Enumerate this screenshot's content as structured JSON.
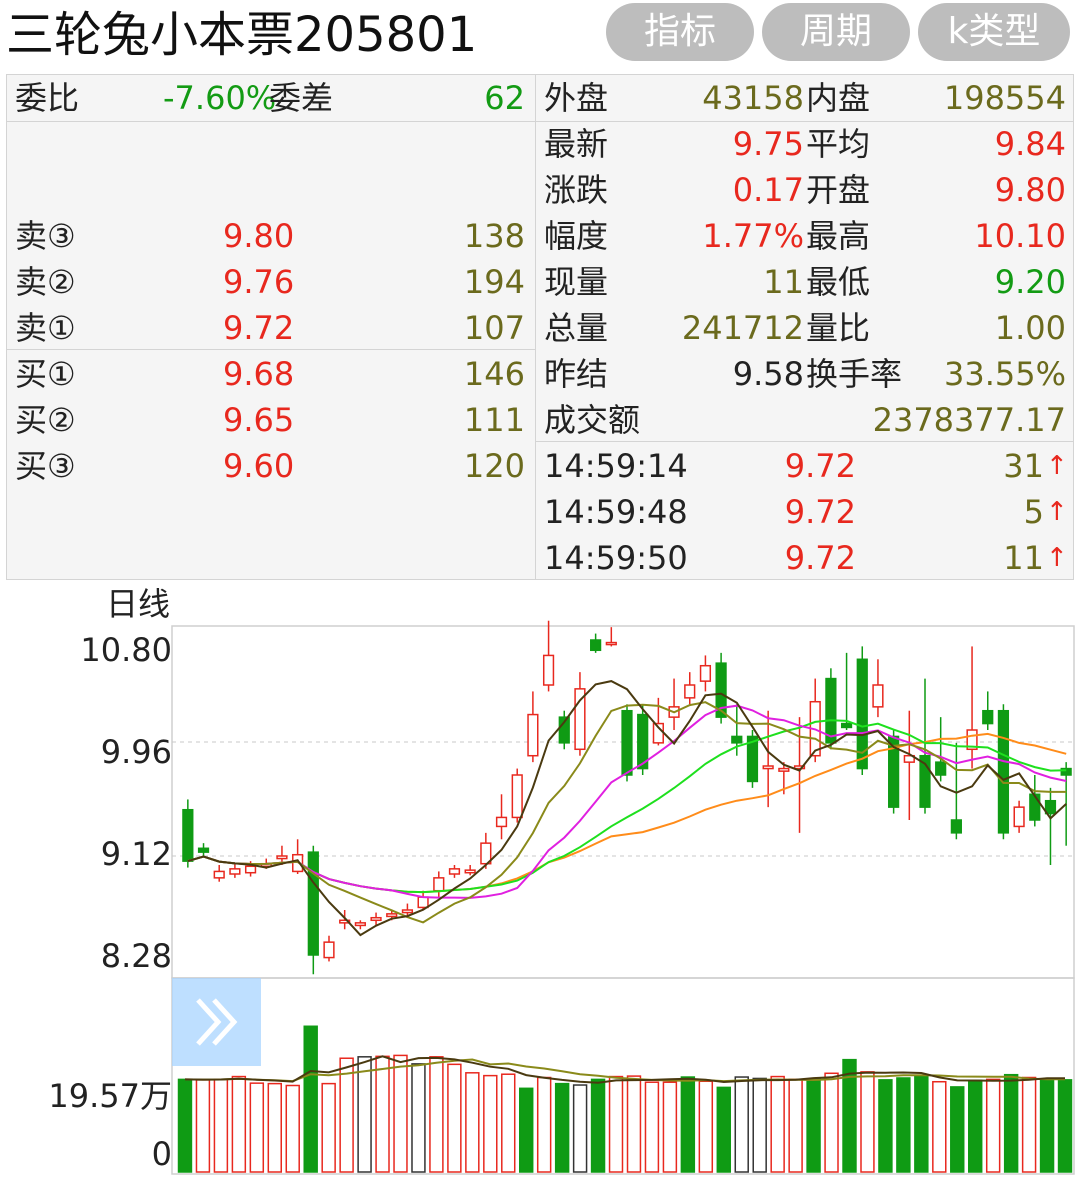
{
  "header": {
    "title": "三轮兔小本票205801",
    "buttons": [
      "指标",
      "周期",
      "k类型"
    ]
  },
  "left_panel": {
    "weibi_label": "委比",
    "weibi_value": "-7.60%",
    "weicha_label": "委差",
    "weicha_value": "62",
    "asks": [
      {
        "label": "卖③",
        "price": "9.80",
        "volume": "138"
      },
      {
        "label": "卖②",
        "price": "9.76",
        "volume": "194"
      },
      {
        "label": "卖①",
        "price": "9.72",
        "volume": "107"
      }
    ],
    "bids": [
      {
        "label": "买①",
        "price": "9.68",
        "volume": "146"
      },
      {
        "label": "买②",
        "price": "9.65",
        "volume": "111"
      },
      {
        "label": "买③",
        "price": "9.60",
        "volume": "120"
      }
    ]
  },
  "right_panel": {
    "waipan_label": "外盘",
    "waipan_value": "43158",
    "neipan_label": "内盘",
    "neipan_value": "198554",
    "stats": [
      {
        "l1": "最新",
        "v1": "9.75",
        "c1": "red",
        "l2": "平均",
        "v2": "9.84",
        "c2": "red"
      },
      {
        "l1": "涨跌",
        "v1": "0.17",
        "c1": "red",
        "l2": "开盘",
        "v2": "9.80",
        "c2": "red"
      },
      {
        "l1": "幅度",
        "v1": "1.77%",
        "c1": "red",
        "l2": "最高",
        "v2": "10.10",
        "c2": "red"
      },
      {
        "l1": "现量",
        "v1": "11",
        "c1": "olive",
        "l2": "最低",
        "v2": "9.20",
        "c2": "green"
      },
      {
        "l1": "总量",
        "v1": "241712",
        "c1": "olive",
        "l2": "量比",
        "v2": "1.00",
        "c2": "olive"
      },
      {
        "l1": "昨结",
        "v1": "9.58",
        "c1": "dark",
        "l2": "换手率",
        "v2": "33.55%",
        "c2": "olive"
      }
    ],
    "turnover_label": "成交额",
    "turnover_value": "2378377.17",
    "ticks": [
      {
        "time": "14:59:14",
        "price": "9.72",
        "volume": "31",
        "arrow": "↑"
      },
      {
        "time": "14:59:48",
        "price": "9.72",
        "volume": "5",
        "arrow": "↑"
      },
      {
        "time": "14:59:50",
        "price": "9.72",
        "volume": "11",
        "arrow": "↑"
      }
    ]
  },
  "chart": {
    "period_label": "日线",
    "price_axis": [
      "10.80",
      "9.96",
      "9.12",
      "8.28"
    ],
    "volume_axis": [
      "19.57万",
      "0"
    ],
    "colors": {
      "up": "#e8281e",
      "down": "#0f9b14",
      "ma5": "#4a3a10",
      "ma10": "#8a8a1a",
      "ma20": "#e020e0",
      "ma30": "#1ee01e",
      "ma60": "#ff8c1a"
    }
  },
  "chart_data": {
    "type": "candlestick",
    "ylim": [
      8.28,
      10.8
    ],
    "candles": [
      [
        9.48,
        9.08,
        9.56,
        9.03
      ],
      [
        9.18,
        9.15,
        9.22,
        9.12
      ],
      [
        8.95,
        9.0,
        9.05,
        8.92
      ],
      [
        8.98,
        9.02,
        9.06,
        8.95
      ],
      [
        8.99,
        9.04,
        9.08,
        8.96
      ],
      [
        9.04,
        9.06,
        9.1,
        9.02
      ],
      [
        9.1,
        9.12,
        9.2,
        9.05
      ],
      [
        9.0,
        9.13,
        9.25,
        8.98
      ],
      [
        9.15,
        8.35,
        9.2,
        8.2
      ],
      [
        8.33,
        8.45,
        8.5,
        8.3
      ],
      [
        8.6,
        8.62,
        8.7,
        8.55
      ],
      [
        8.58,
        8.6,
        8.62,
        8.55
      ],
      [
        8.62,
        8.64,
        8.68,
        8.58
      ],
      [
        8.65,
        8.67,
        8.7,
        8.62
      ],
      [
        8.68,
        8.7,
        8.75,
        8.65
      ],
      [
        8.72,
        8.8,
        8.85,
        8.7
      ],
      [
        8.85,
        8.95,
        9.0,
        8.8
      ],
      [
        8.98,
        9.02,
        9.05,
        8.95
      ],
      [
        8.99,
        9.01,
        9.05,
        8.97
      ],
      [
        9.06,
        9.22,
        9.3,
        9.02
      ],
      [
        9.35,
        9.42,
        9.6,
        9.25
      ],
      [
        9.42,
        9.75,
        9.8,
        9.38
      ],
      [
        9.9,
        10.22,
        10.4,
        9.85
      ],
      [
        10.45,
        10.68,
        10.95,
        10.4
      ],
      [
        10.2,
        10.0,
        10.25,
        9.95
      ],
      [
        9.95,
        10.42,
        10.55,
        9.9
      ],
      [
        10.8,
        10.72,
        10.85,
        10.7
      ],
      [
        10.77,
        10.78,
        10.9,
        10.75
      ],
      [
        10.25,
        9.75,
        10.3,
        9.7
      ],
      [
        10.22,
        9.8,
        10.3,
        9.75
      ],
      [
        10.0,
        10.15,
        10.35,
        9.98
      ],
      [
        10.2,
        10.28,
        10.5,
        10.1
      ],
      [
        10.35,
        10.45,
        10.55,
        10.3
      ],
      [
        10.48,
        10.6,
        10.68,
        10.4
      ],
      [
        10.62,
        10.2,
        10.7,
        10.15
      ],
      [
        10.05,
        10.0,
        10.3,
        9.9
      ],
      [
        10.05,
        9.7,
        10.1,
        9.65
      ],
      [
        9.8,
        9.82,
        10.25,
        9.5
      ],
      [
        9.78,
        9.8,
        9.85,
        9.6
      ],
      [
        9.8,
        9.82,
        10.2,
        9.3
      ],
      [
        9.9,
        10.32,
        10.5,
        9.85
      ],
      [
        10.5,
        10.0,
        10.58,
        9.95
      ],
      [
        10.15,
        10.12,
        10.7,
        10.1
      ],
      [
        10.65,
        9.8,
        10.75,
        9.75
      ],
      [
        10.28,
        10.45,
        10.65,
        10.2
      ],
      [
        10.05,
        9.5,
        10.1,
        9.45
      ],
      [
        9.85,
        9.9,
        10.25,
        9.4
      ],
      [
        9.9,
        9.5,
        10.5,
        9.45
      ],
      [
        9.85,
        9.75,
        10.2,
        9.7
      ],
      [
        9.4,
        9.3,
        10.0,
        9.25
      ],
      [
        9.95,
        10.1,
        10.75,
        9.8
      ],
      [
        10.25,
        10.15,
        10.4,
        10.1
      ],
      [
        10.25,
        9.3,
        10.3,
        9.25
      ],
      [
        9.35,
        9.5,
        9.55,
        9.3
      ],
      [
        9.6,
        9.4,
        9.75,
        9.35
      ],
      [
        9.55,
        9.45,
        9.65,
        9.05
      ],
      [
        9.8,
        9.75,
        9.85,
        9.2
      ]
    ],
    "volumes": [
      [
        19.7,
        "down"
      ],
      [
        19.6,
        "up"
      ],
      [
        19.7,
        "up"
      ],
      [
        20.3,
        "up"
      ],
      [
        18.9,
        "up"
      ],
      [
        18.8,
        "up"
      ],
      [
        18.4,
        "up"
      ],
      [
        31.0,
        "down"
      ],
      [
        18.8,
        "up"
      ],
      [
        24.2,
        "up"
      ],
      [
        24.5,
        "flat"
      ],
      [
        24.6,
        "up"
      ],
      [
        24.8,
        "up"
      ],
      [
        23.0,
        "flat"
      ],
      [
        24.5,
        "up"
      ],
      [
        22.9,
        "up"
      ],
      [
        21.1,
        "up"
      ],
      [
        20.5,
        "up"
      ],
      [
        20.8,
        "up"
      ],
      [
        17.8,
        "down"
      ],
      [
        20.1,
        "up"
      ],
      [
        18.8,
        "down"
      ],
      [
        18.5,
        "flat"
      ],
      [
        19.7,
        "down"
      ],
      [
        20.3,
        "up"
      ],
      [
        20.4,
        "up"
      ],
      [
        19.1,
        "up"
      ],
      [
        19.1,
        "up"
      ],
      [
        20.2,
        "down"
      ],
      [
        19.3,
        "up"
      ],
      [
        18.0,
        "down"
      ],
      [
        20.2,
        "flat"
      ],
      [
        19.9,
        "flat"
      ],
      [
        20.3,
        "up"
      ],
      [
        19.7,
        "up"
      ],
      [
        19.8,
        "down"
      ],
      [
        21.0,
        "up"
      ],
      [
        23.9,
        "down"
      ],
      [
        21.3,
        "up"
      ],
      [
        19.6,
        "down"
      ],
      [
        20.0,
        "down"
      ],
      [
        20.5,
        "down"
      ],
      [
        19.2,
        "up"
      ],
      [
        18.1,
        "down"
      ],
      [
        19.5,
        "down"
      ],
      [
        19.7,
        "up"
      ],
      [
        20.7,
        "down"
      ],
      [
        20.1,
        "up"
      ],
      [
        19.7,
        "down"
      ],
      [
        19.6,
        "down"
      ]
    ]
  }
}
